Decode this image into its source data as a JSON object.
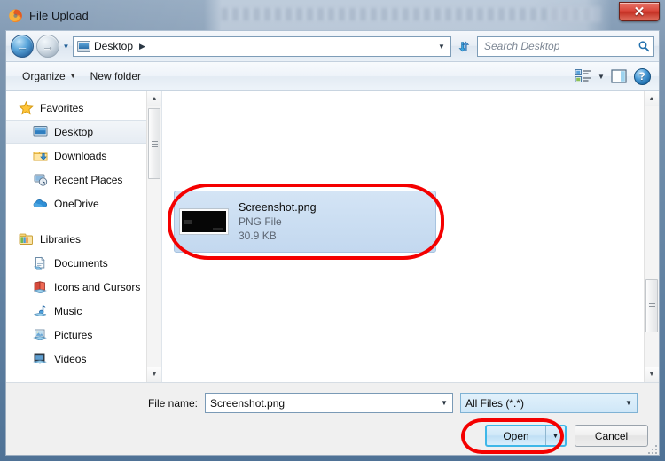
{
  "window": {
    "title": "File Upload",
    "app_icon": "firefox-icon",
    "close_label": "✕"
  },
  "addressbar": {
    "back_icon": "back-arrow-icon",
    "forward_icon": "forward-arrow-icon",
    "history_icon": "chevron-down-icon",
    "breadcrumb_icon": "desktop-icon",
    "breadcrumb": "Desktop",
    "breadcrumb_separator": "▶",
    "dropdown_icon": "chevron-down-icon",
    "refresh_icon": "refresh-icon"
  },
  "search": {
    "placeholder": "Search Desktop",
    "icon": "search-magnifier-icon"
  },
  "toolbar": {
    "organize_label": "Organize",
    "organize_caret": "▼",
    "new_folder_label": "New folder",
    "views_icon": "views-icon",
    "views_caret": "▼",
    "preview_pane_icon": "preview-pane-icon",
    "help_icon": "help-icon",
    "help_label": "?"
  },
  "navpane": {
    "groups": [
      {
        "label": "Favorites",
        "icon": "star-icon",
        "items": [
          {
            "label": "Desktop",
            "icon": "desktop-icon",
            "selected": true
          },
          {
            "label": "Downloads",
            "icon": "downloads-folder-icon",
            "selected": false
          },
          {
            "label": "Recent Places",
            "icon": "recent-places-icon",
            "selected": false
          },
          {
            "label": "OneDrive",
            "icon": "onedrive-cloud-icon",
            "selected": false
          }
        ]
      },
      {
        "label": "Libraries",
        "icon": "libraries-icon",
        "items": [
          {
            "label": "Documents",
            "icon": "documents-library-icon",
            "selected": false
          },
          {
            "label": "Icons and Cursors",
            "icon": "icons-cursors-library-icon",
            "selected": false
          },
          {
            "label": "Music",
            "icon": "music-library-icon",
            "selected": false
          },
          {
            "label": "Pictures",
            "icon": "pictures-library-icon",
            "selected": false
          },
          {
            "label": "Videos",
            "icon": "videos-library-icon",
            "selected": false
          }
        ]
      }
    ]
  },
  "filelist": {
    "items": [
      {
        "name": "Screenshot.png",
        "type": "PNG File",
        "size": "30.9 KB",
        "selected": true,
        "thumbnail": "black-screenshot-thumbnail"
      }
    ]
  },
  "bottom": {
    "filename_label": "File name:",
    "filename_value": "Screenshot.png",
    "filetype_value": "All Files (*.*)",
    "open_label": "Open",
    "open_split_caret": "▼",
    "cancel_label": "Cancel"
  },
  "annotations": {
    "file_highlight": "red-oval-around-selected-file",
    "open_highlight": "red-oval-around-open-button",
    "color": "#f40000"
  },
  "scrollbars": {
    "up_arrow": "▲",
    "down_arrow": "▼"
  }
}
